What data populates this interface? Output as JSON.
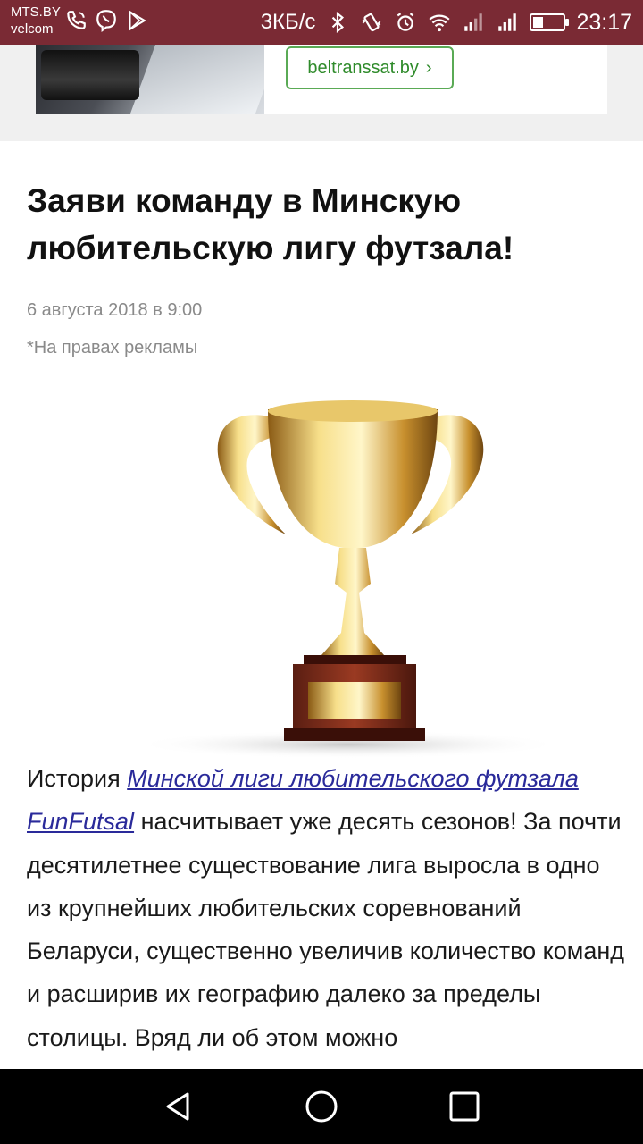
{
  "status_bar": {
    "carrier_line1": "MTS.BY",
    "carrier_line2": "velcom",
    "net_speed": "3КБ/с",
    "time": "23:17",
    "battery_level": 0.3
  },
  "ad": {
    "link_label": "beltranssat.by",
    "link_arrow": "›"
  },
  "article": {
    "title": "Заяви команду в Минскую любительскую лигу футзала!",
    "date": "6 августа 2018 в 9:00",
    "ad_note": "*На правах рекламы",
    "body_intro": "История ",
    "body_link1": "Минской лиги любительского футзала",
    "body_space": " ",
    "body_link2": "FunFutsal",
    "body_rest": " насчитывает уже десять сезонов! За почти десятилетнее существование лига выросла в одно из крупнейших любительских соревнований Беларуси, существенно увеличив количество команд и расширив их географию далеко за пределы столицы. Вряд ли об этом можно"
  },
  "icons": {
    "status_left": [
      "phone-icon",
      "viber-icon",
      "play-store-icon"
    ],
    "status_right": [
      "bluetooth-icon",
      "vibrate-icon",
      "alarm-icon",
      "wifi-icon",
      "signal-icon",
      "signal-icon",
      "battery-icon"
    ],
    "nav": [
      "back-icon",
      "home-icon",
      "recents-icon"
    ]
  },
  "colors": {
    "status_bar": "#7a2a34",
    "ad_link": "#2f8b2b",
    "link": "#2a2a9a"
  }
}
